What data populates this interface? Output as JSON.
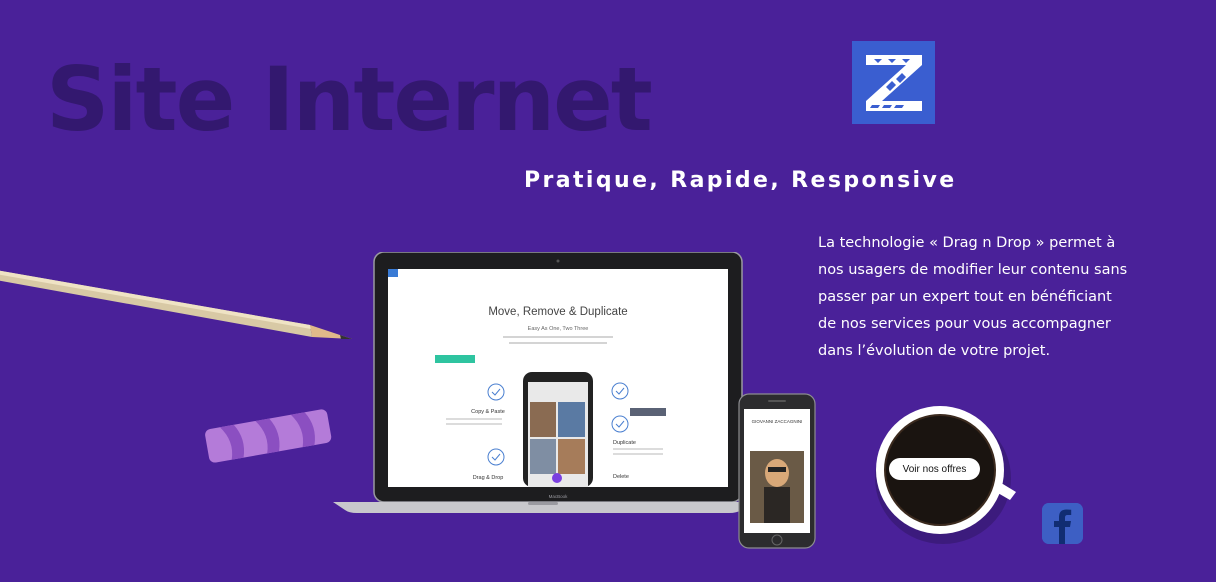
{
  "hero": {
    "title": "Site Internet",
    "tagline": "Pratique, Rapide, Responsive",
    "description": "La technologie « Drag n Drop » permet à nos usagers de modifier leur contenu sans passer par un expert tout en bénéficiant de nos services pour vous accompagner dans l’évolution de votre projet."
  },
  "cta": {
    "label": "Voir nos offres"
  },
  "laptop_screen": {
    "heading": "Move, Remove & Duplicate",
    "subheading": "Easy As One, Two Three",
    "features": [
      "Copy & Paste",
      "Duplicate",
      "Drag & Drop",
      "Delete"
    ],
    "brand": "MacBook"
  },
  "phone_screen": {
    "brand": "GIOVANNI ZACCAGNINI"
  },
  "icons": {
    "logo": "zebra-z-logo-icon",
    "facebook": "facebook-icon"
  },
  "colors": {
    "background": "#4a2199",
    "title": "#33186f",
    "logo": "#3a5ed0",
    "facebook": "#3d5fc4"
  }
}
